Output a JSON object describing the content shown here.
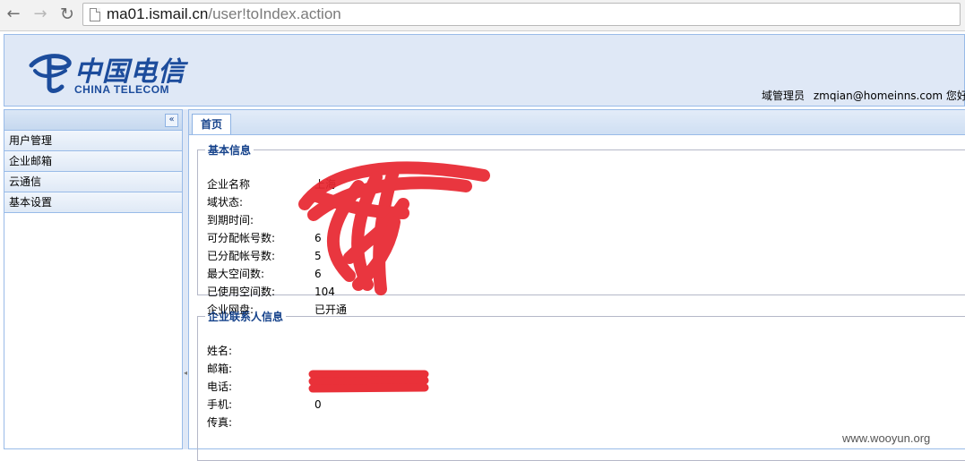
{
  "browser": {
    "url_host": "ma01.ismail.cn",
    "url_path": "/user!toIndex.action",
    "back": "←",
    "forward": "→",
    "reload": "↻"
  },
  "banner": {
    "logo_cn": "中国电信",
    "logo_en": "CHINA TELECOM",
    "role": "域管理员",
    "email": "zmqian@homeinns.com",
    "greeting": "您好! 您"
  },
  "sidebar": {
    "collapse": "«",
    "items": [
      {
        "label": "用户管理"
      },
      {
        "label": "企业邮箱"
      },
      {
        "label": "云通信"
      },
      {
        "label": "基本设置"
      }
    ]
  },
  "tabs": [
    {
      "label": "首页"
    }
  ],
  "basic_info": {
    "legend": "基本信息",
    "rows": [
      {
        "label": "企业名称",
        "value": "上海"
      },
      {
        "label": "域状态:",
        "value": ""
      },
      {
        "label": "到期时间:",
        "value": ""
      },
      {
        "label": "可分配帐号数:",
        "value": "6"
      },
      {
        "label": "已分配帐号数:",
        "value": "5"
      },
      {
        "label": "最大空间数:",
        "value": "6"
      },
      {
        "label": "已使用空间数:",
        "value": "104"
      },
      {
        "label": "企业网盘:",
        "value": "已开通"
      }
    ]
  },
  "contact_info": {
    "legend": "企业联系人信息",
    "rows": [
      {
        "label": "姓名:",
        "value": ""
      },
      {
        "label": "邮箱:",
        "value": ""
      },
      {
        "label": "电话:",
        "value": ""
      },
      {
        "label": "手机:",
        "value": "0"
      },
      {
        "label": "传真:",
        "value": ""
      }
    ]
  },
  "watermark": "www.wooyun.org",
  "colors": {
    "redaction": "#e8262f",
    "header_blue": "#15428b",
    "panel_bg": "#dfe8f6"
  }
}
